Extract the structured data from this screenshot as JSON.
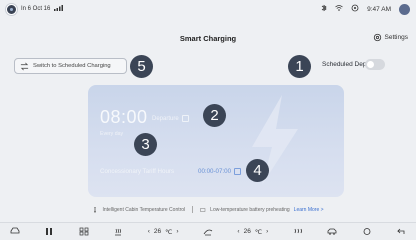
{
  "status_bar": {
    "left_text": "In 6 Oct 16",
    "time": "9:47 AM"
  },
  "header": {
    "title": "Smart Charging",
    "settings_label": "Settings"
  },
  "switch_button": {
    "label": "Switch to Scheduled Charging"
  },
  "scheduled_departure": {
    "label": "Scheduled Departure",
    "enabled": false
  },
  "card": {
    "time": "08:00",
    "departure_label": "Departure",
    "repeat_label": "Every day",
    "offpeak_label": "Concessionary Tariff Hours",
    "offpeak_range": "00:00-07:00"
  },
  "badges": [
    "1",
    "2",
    "3",
    "4",
    "5"
  ],
  "info_bar": {
    "item1": "Intelligent Cabin Temperature Control",
    "item2": "Low-temperature battery preheating",
    "learn_more": "Learn More >"
  },
  "dock": {
    "left_temp": "26",
    "right_temp": "26",
    "temp_unit": "℃"
  },
  "colors": {
    "accent": "#3a6fd0",
    "badge": "#3b4556",
    "card_top": "#c9d5ea"
  }
}
